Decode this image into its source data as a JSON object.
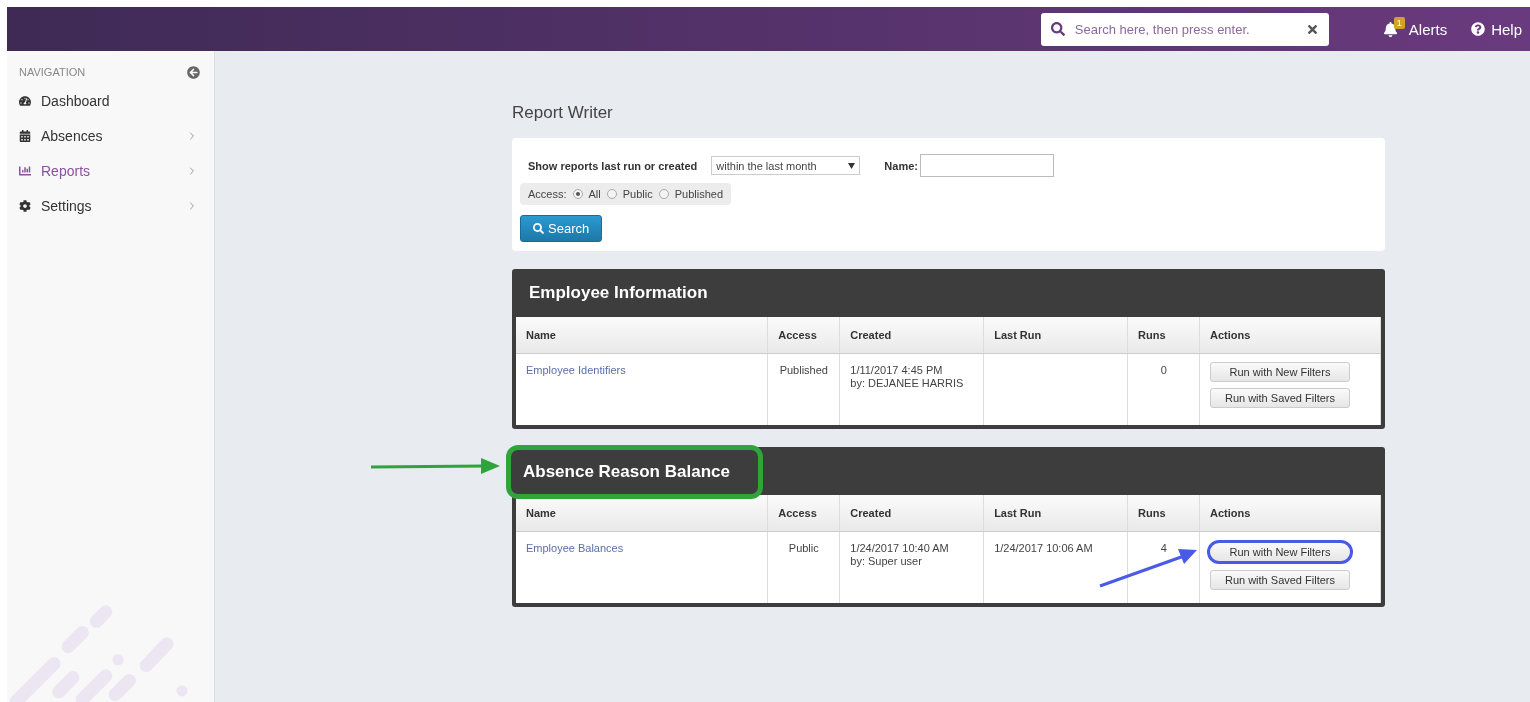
{
  "topbar": {
    "search_placeholder": "Search here, then press enter.",
    "alerts": {
      "label": "Alerts",
      "badge": "1"
    },
    "help": "Help"
  },
  "sidebar": {
    "header": "NAVIGATION",
    "items": [
      {
        "label": "Dashboard",
        "selected": false,
        "expandable": false
      },
      {
        "label": "Absences",
        "selected": false,
        "expandable": true
      },
      {
        "label": "Reports",
        "selected": true,
        "expandable": true
      },
      {
        "label": "Settings",
        "selected": false,
        "expandable": true
      }
    ]
  },
  "page_title": "Report Writer",
  "filter": {
    "label": "Show reports last run or created",
    "period": "within the last month",
    "name_label": "Name:",
    "access_label": "Access:",
    "access_options": [
      {
        "label": "All",
        "selected": true
      },
      {
        "label": "Public",
        "selected": false
      },
      {
        "label": "Published",
        "selected": false
      }
    ],
    "search_button": "Search"
  },
  "sections": [
    {
      "title": "Employee Information",
      "highlighted": false,
      "columns": [
        "Name",
        "Access",
        "Created",
        "Last Run",
        "Runs",
        "Actions"
      ],
      "rows": [
        {
          "name": "Employee Identifiers",
          "access": "Published",
          "created": "1/11/2017 4:45 PM",
          "created_by": "by: DEJANEE HARRIS",
          "runs": "0",
          "actions": [
            {
              "label": "Run with New Filters",
              "highlighted": false
            },
            {
              "label": "Run with Saved Filters",
              "highlighted": false
            }
          ]
        }
      ]
    },
    {
      "title": "Absence Reason Balance",
      "highlighted": true,
      "columns": [
        "Name",
        "Access",
        "Created",
        "Last Run",
        "Runs",
        "Actions"
      ],
      "rows": [
        {
          "name": "Employee Balances",
          "access": "Public",
          "created": "1/24/2017 10:40 AM",
          "created_by": "by: Super user",
          "last_run": "1/24/2017 10:06 AM",
          "runs": "4",
          "actions": [
            {
              "label": "Run with New Filters",
              "highlighted": true
            },
            {
              "label": "Run with Saved Filters",
              "highlighted": false
            }
          ]
        }
      ]
    }
  ]
}
